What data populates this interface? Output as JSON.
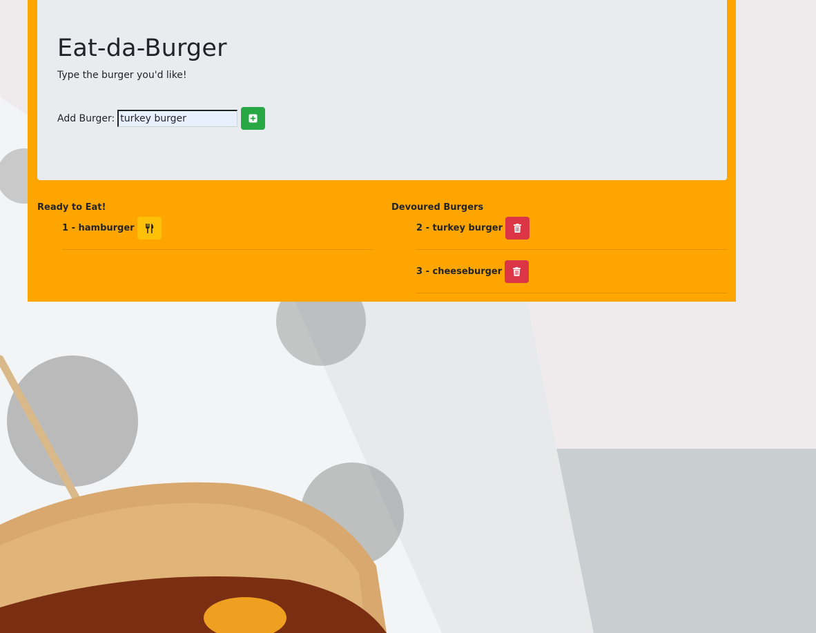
{
  "header": {
    "title": "Eat-da-Burger",
    "subtitle": "Type the burger you'd like!"
  },
  "add_form": {
    "label": "Add Burger:",
    "input_value": "turkey burger",
    "button_icon": "plus-square-icon"
  },
  "ready": {
    "heading": "Ready to Eat!",
    "items": [
      {
        "label": "1 - hamburger",
        "action_icon": "utensils-icon"
      }
    ]
  },
  "devoured": {
    "heading": "Devoured Burgers",
    "items": [
      {
        "label": "2 - turkey burger",
        "action_icon": "trash-icon"
      },
      {
        "label": "3 - cheeseburger",
        "action_icon": "trash-icon"
      }
    ]
  },
  "colors": {
    "container_bg": "#ffa500",
    "jumbotron_bg": "#e9ecef",
    "success": "#28a745",
    "warning": "#ffc107",
    "danger": "#dc3545"
  }
}
